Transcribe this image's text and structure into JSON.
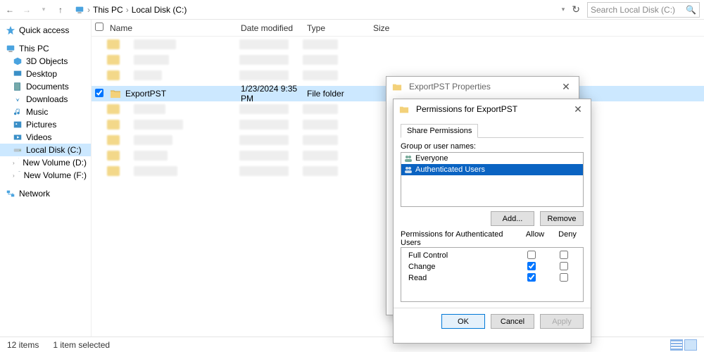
{
  "breadcrumb": {
    "a": "This PC",
    "b": "Local Disk (C:)"
  },
  "search": {
    "placeholder": "Search Local Disk (C:)"
  },
  "sidebar": {
    "quick": "Quick access",
    "thispc": "This PC",
    "objects3d": "3D Objects",
    "desktop": "Desktop",
    "documents": "Documents",
    "downloads": "Downloads",
    "music": "Music",
    "pictures": "Pictures",
    "videos": "Videos",
    "localc": "Local Disk (C:)",
    "vold": "New Volume (D:)",
    "volf": "New Volume (F:)",
    "network": "Network"
  },
  "columns": {
    "name": "Name",
    "date": "Date modified",
    "type": "Type",
    "size": "Size"
  },
  "row": {
    "name": "ExportPST",
    "date": "1/23/2024 9:35 PM",
    "type": "File folder"
  },
  "status": {
    "items": "12 items",
    "sel": "1 item selected"
  },
  "prop": {
    "title": "ExportPST Properties"
  },
  "perm": {
    "title": "Permissions for ExportPST",
    "tab": "Share Permissions",
    "group_label": "Group or user names:",
    "everyone": "Everyone",
    "auth": "Authenticated Users",
    "add": "Add...",
    "remove": "Remove",
    "perm_for": "Permissions for Authenticated Users",
    "allow": "Allow",
    "deny": "Deny",
    "full": "Full Control",
    "change": "Change",
    "read": "Read",
    "ok": "OK",
    "cancel": "Cancel",
    "apply": "Apply"
  }
}
